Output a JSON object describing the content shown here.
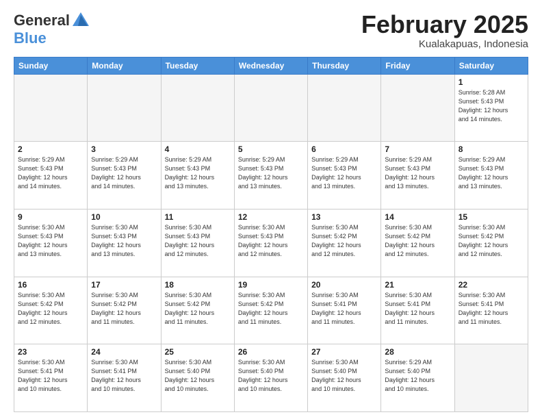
{
  "header": {
    "logo_general": "General",
    "logo_blue": "Blue",
    "title": "February 2025",
    "subtitle": "Kualakapuas, Indonesia"
  },
  "days_of_week": [
    "Sunday",
    "Monday",
    "Tuesday",
    "Wednesday",
    "Thursday",
    "Friday",
    "Saturday"
  ],
  "weeks": [
    [
      {
        "day": "",
        "info": ""
      },
      {
        "day": "",
        "info": ""
      },
      {
        "day": "",
        "info": ""
      },
      {
        "day": "",
        "info": ""
      },
      {
        "day": "",
        "info": ""
      },
      {
        "day": "",
        "info": ""
      },
      {
        "day": "1",
        "info": "Sunrise: 5:28 AM\nSunset: 5:43 PM\nDaylight: 12 hours\nand 14 minutes."
      }
    ],
    [
      {
        "day": "2",
        "info": "Sunrise: 5:29 AM\nSunset: 5:43 PM\nDaylight: 12 hours\nand 14 minutes."
      },
      {
        "day": "3",
        "info": "Sunrise: 5:29 AM\nSunset: 5:43 PM\nDaylight: 12 hours\nand 14 minutes."
      },
      {
        "day": "4",
        "info": "Sunrise: 5:29 AM\nSunset: 5:43 PM\nDaylight: 12 hours\nand 13 minutes."
      },
      {
        "day": "5",
        "info": "Sunrise: 5:29 AM\nSunset: 5:43 PM\nDaylight: 12 hours\nand 13 minutes."
      },
      {
        "day": "6",
        "info": "Sunrise: 5:29 AM\nSunset: 5:43 PM\nDaylight: 12 hours\nand 13 minutes."
      },
      {
        "day": "7",
        "info": "Sunrise: 5:29 AM\nSunset: 5:43 PM\nDaylight: 12 hours\nand 13 minutes."
      },
      {
        "day": "8",
        "info": "Sunrise: 5:29 AM\nSunset: 5:43 PM\nDaylight: 12 hours\nand 13 minutes."
      }
    ],
    [
      {
        "day": "9",
        "info": "Sunrise: 5:30 AM\nSunset: 5:43 PM\nDaylight: 12 hours\nand 13 minutes."
      },
      {
        "day": "10",
        "info": "Sunrise: 5:30 AM\nSunset: 5:43 PM\nDaylight: 12 hours\nand 13 minutes."
      },
      {
        "day": "11",
        "info": "Sunrise: 5:30 AM\nSunset: 5:43 PM\nDaylight: 12 hours\nand 12 minutes."
      },
      {
        "day": "12",
        "info": "Sunrise: 5:30 AM\nSunset: 5:43 PM\nDaylight: 12 hours\nand 12 minutes."
      },
      {
        "day": "13",
        "info": "Sunrise: 5:30 AM\nSunset: 5:42 PM\nDaylight: 12 hours\nand 12 minutes."
      },
      {
        "day": "14",
        "info": "Sunrise: 5:30 AM\nSunset: 5:42 PM\nDaylight: 12 hours\nand 12 minutes."
      },
      {
        "day": "15",
        "info": "Sunrise: 5:30 AM\nSunset: 5:42 PM\nDaylight: 12 hours\nand 12 minutes."
      }
    ],
    [
      {
        "day": "16",
        "info": "Sunrise: 5:30 AM\nSunset: 5:42 PM\nDaylight: 12 hours\nand 12 minutes."
      },
      {
        "day": "17",
        "info": "Sunrise: 5:30 AM\nSunset: 5:42 PM\nDaylight: 12 hours\nand 11 minutes."
      },
      {
        "day": "18",
        "info": "Sunrise: 5:30 AM\nSunset: 5:42 PM\nDaylight: 12 hours\nand 11 minutes."
      },
      {
        "day": "19",
        "info": "Sunrise: 5:30 AM\nSunset: 5:42 PM\nDaylight: 12 hours\nand 11 minutes."
      },
      {
        "day": "20",
        "info": "Sunrise: 5:30 AM\nSunset: 5:41 PM\nDaylight: 12 hours\nand 11 minutes."
      },
      {
        "day": "21",
        "info": "Sunrise: 5:30 AM\nSunset: 5:41 PM\nDaylight: 12 hours\nand 11 minutes."
      },
      {
        "day": "22",
        "info": "Sunrise: 5:30 AM\nSunset: 5:41 PM\nDaylight: 12 hours\nand 11 minutes."
      }
    ],
    [
      {
        "day": "23",
        "info": "Sunrise: 5:30 AM\nSunset: 5:41 PM\nDaylight: 12 hours\nand 10 minutes."
      },
      {
        "day": "24",
        "info": "Sunrise: 5:30 AM\nSunset: 5:41 PM\nDaylight: 12 hours\nand 10 minutes."
      },
      {
        "day": "25",
        "info": "Sunrise: 5:30 AM\nSunset: 5:40 PM\nDaylight: 12 hours\nand 10 minutes."
      },
      {
        "day": "26",
        "info": "Sunrise: 5:30 AM\nSunset: 5:40 PM\nDaylight: 12 hours\nand 10 minutes."
      },
      {
        "day": "27",
        "info": "Sunrise: 5:30 AM\nSunset: 5:40 PM\nDaylight: 12 hours\nand 10 minutes."
      },
      {
        "day": "28",
        "info": "Sunrise: 5:29 AM\nSunset: 5:40 PM\nDaylight: 12 hours\nand 10 minutes."
      },
      {
        "day": "",
        "info": ""
      }
    ]
  ]
}
